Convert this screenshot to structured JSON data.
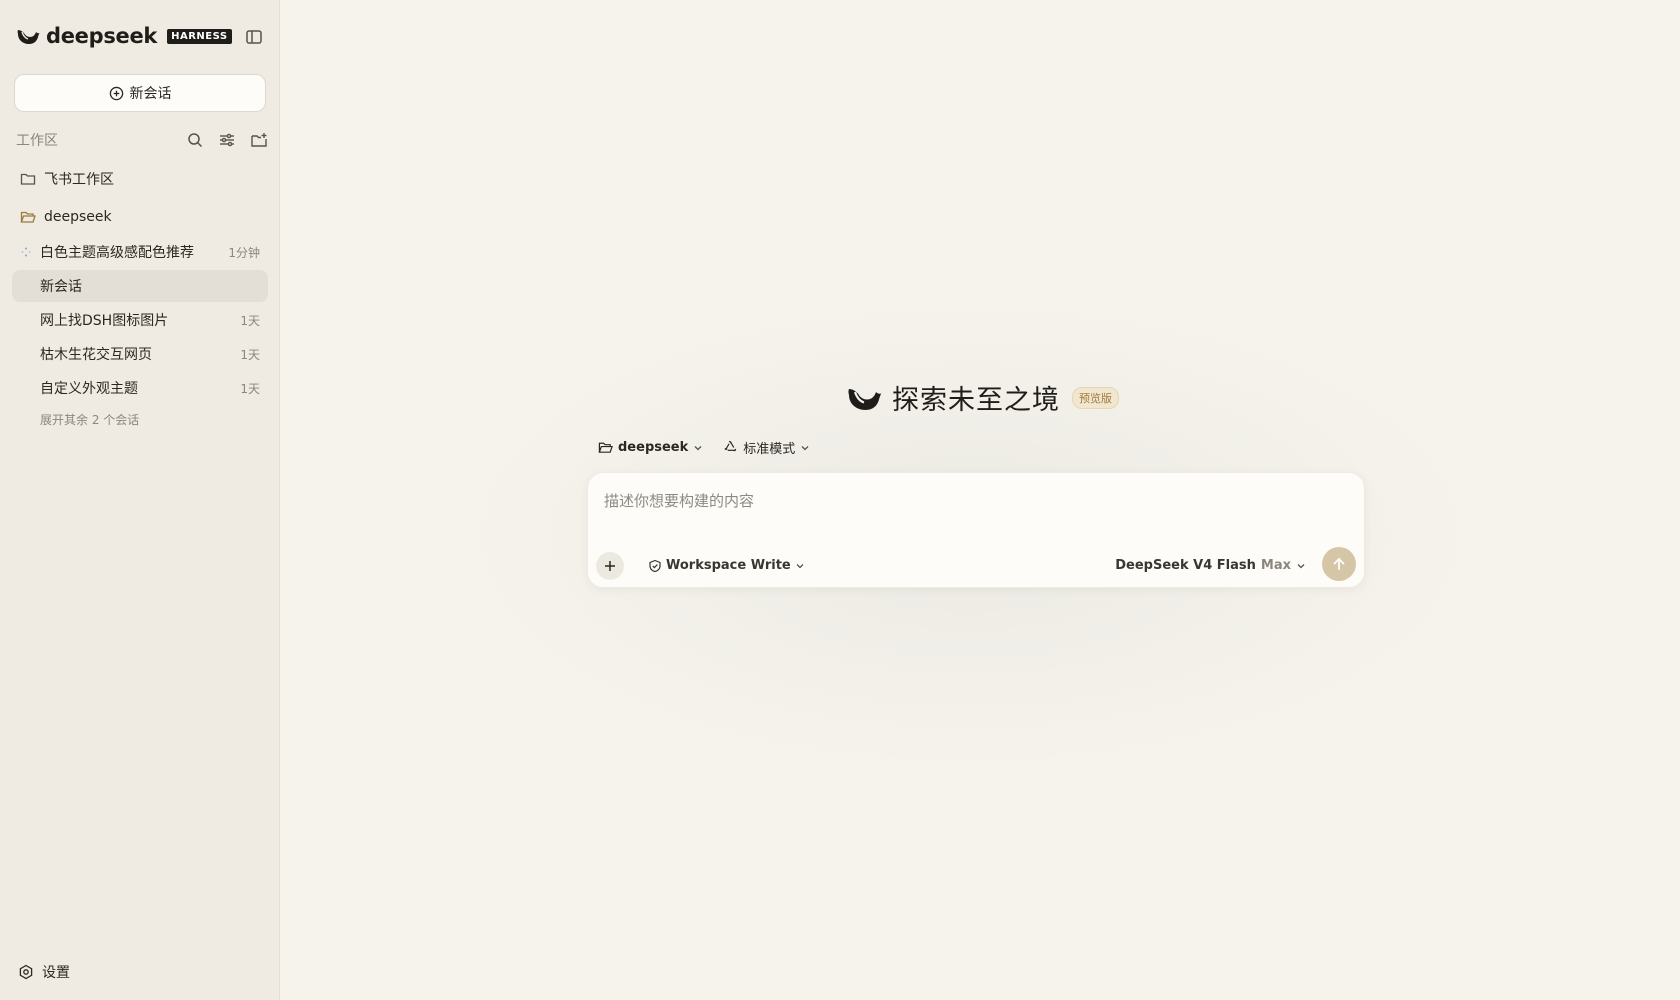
{
  "brand": {
    "name": "deepseek",
    "badge": "HARNESS"
  },
  "sidebar": {
    "new_chat_label": "新会话",
    "workspace_title": "工作区",
    "folders": [
      {
        "label": "飞书工作区",
        "icon": "folder-icon"
      },
      {
        "label": "deepseek",
        "icon": "folder-open-icon"
      }
    ],
    "sessions": [
      {
        "title": "白色主题高级感配色推荐",
        "time": "1分钟",
        "status": "running"
      },
      {
        "title": "新会话",
        "time": "",
        "status": "active"
      },
      {
        "title": "网上找DSH图标图片",
        "time": "1天"
      },
      {
        "title": "枯木生花交互网页",
        "time": "1天"
      },
      {
        "title": "自定义外观主题",
        "time": "1天"
      }
    ],
    "expand_more_label": "展开其余 2 个会话",
    "settings_label": "设置"
  },
  "main": {
    "hero_title": "探索未至之境",
    "hero_badge": "预览版",
    "workspace_selector": "deepseek",
    "mode_selector": "标准模式",
    "composer": {
      "placeholder": "描述你想要构建的内容",
      "value": "",
      "permission": "Workspace Write",
      "model": "DeepSeek V4 Flash",
      "model_tier": "Max"
    }
  },
  "colors": {
    "background": "#f6f3ec",
    "sidebar": "#efebe2",
    "send_button": "#d6c6a8",
    "badge_text": "#a07c3b"
  }
}
